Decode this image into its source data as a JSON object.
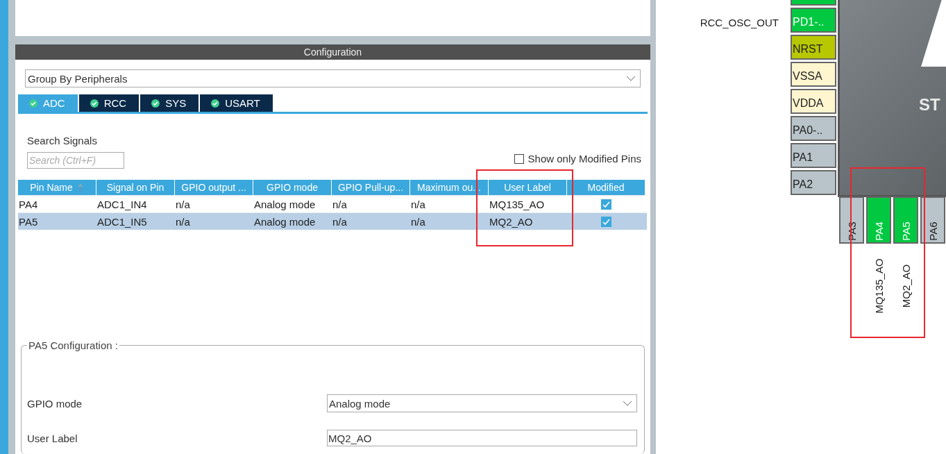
{
  "configuration": {
    "title": "Configuration",
    "group_by": {
      "value": "Group By Peripherals"
    },
    "tabs": [
      {
        "label": "ADC",
        "selected": true
      },
      {
        "label": "RCC",
        "selected": false
      },
      {
        "label": "SYS",
        "selected": false
      },
      {
        "label": "USART",
        "selected": false
      }
    ],
    "search": {
      "label": "Search Signals",
      "placeholder": "Search (Ctrl+F)"
    },
    "show_only_modified": {
      "label": "Show only Modified Pins",
      "checked": false
    },
    "table": {
      "columns": [
        "Pin Name",
        "Signal on Pin",
        "GPIO output ...",
        "GPIO mode",
        "GPIO Pull-up...",
        "Maximum ou...",
        "User Label",
        "Modified"
      ],
      "rows": [
        {
          "cells": [
            "PA4",
            "ADC1_IN4",
            "n/a",
            "Analog mode",
            "n/a",
            "n/a",
            "MQ135_AO"
          ],
          "modified": true,
          "selected": false
        },
        {
          "cells": [
            "PA5",
            "ADC1_IN5",
            "n/a",
            "Analog mode",
            "n/a",
            "n/a",
            "MQ2_AO"
          ],
          "modified": true,
          "selected": true
        }
      ]
    },
    "pin_configuration": {
      "title": "PA5 Configuration :",
      "gpio_mode": {
        "label": "GPIO mode",
        "value": "Analog mode"
      },
      "user_label": {
        "label": "User Label",
        "value": "MQ2_AO"
      }
    }
  },
  "pinout": {
    "chip": {
      "logo_text": "ST"
    },
    "side_labels": [
      "RCC_OSC_OUT"
    ],
    "left_pins": [
      {
        "kind": "signal"
      },
      {
        "label": "PD1-..",
        "kind": "signal"
      },
      {
        "label": "NRST",
        "kind": "reset"
      },
      {
        "label": "VSSA",
        "kind": "power"
      },
      {
        "label": "VDDA",
        "kind": "power"
      },
      {
        "label": "PA0-..",
        "kind": "free"
      },
      {
        "label": "PA1",
        "kind": "free"
      },
      {
        "label": "PA2",
        "kind": "free"
      }
    ],
    "bottom_pins": [
      {
        "label": "PA3",
        "kind": "free"
      },
      {
        "label": "PA4",
        "kind": "signal",
        "user_label": "MQ135_AO"
      },
      {
        "label": "PA5",
        "kind": "signal",
        "user_label": "MQ2_AO"
      },
      {
        "label": "PA6",
        "kind": "free"
      }
    ]
  }
}
